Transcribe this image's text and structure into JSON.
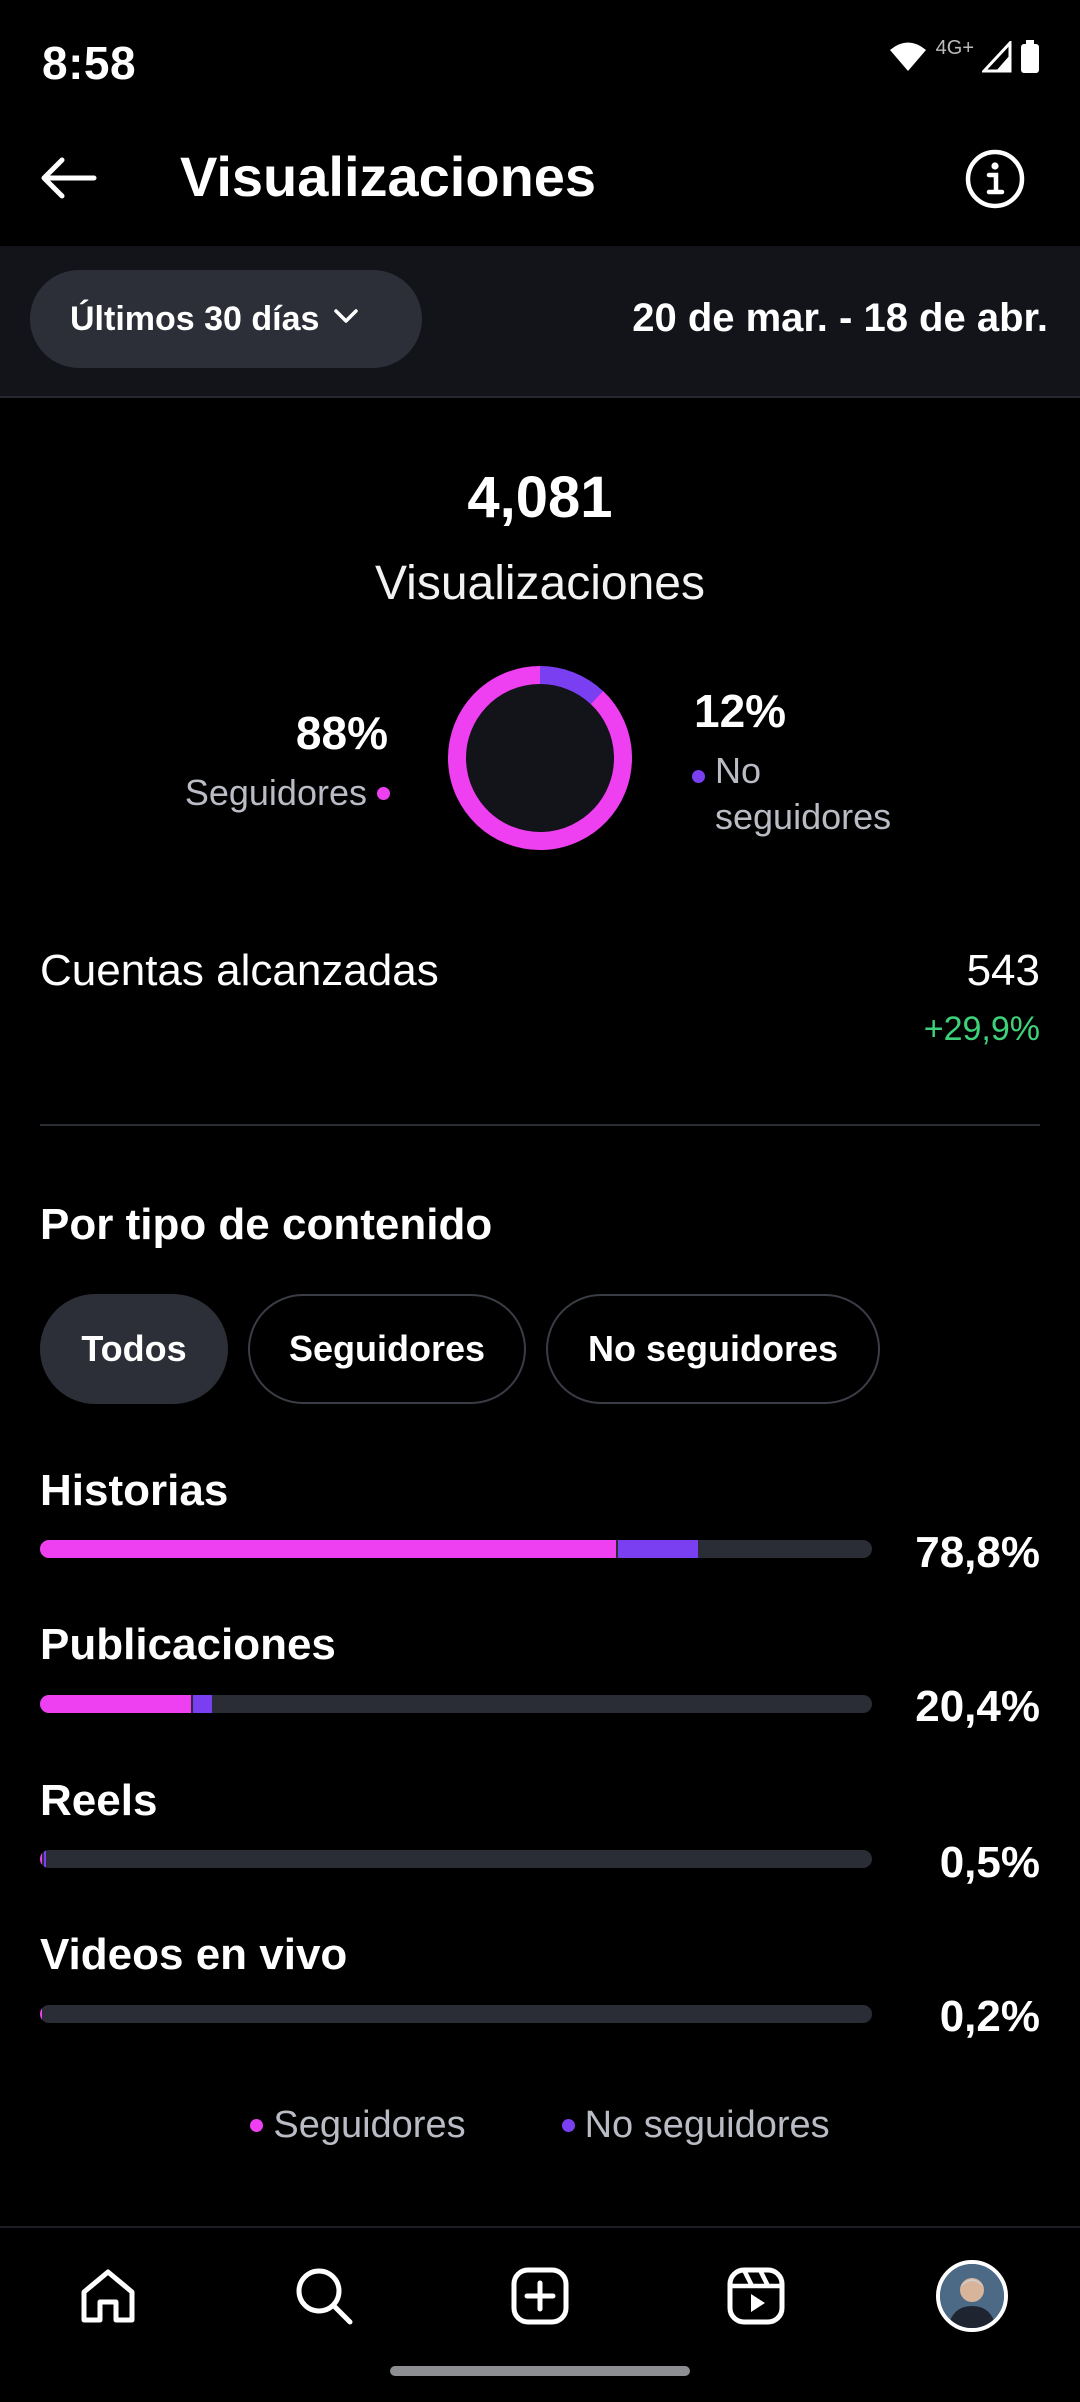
{
  "status_bar": {
    "time": "8:58",
    "network_label": "4G+",
    "icons": [
      "wifi-icon",
      "signal-icon",
      "battery-icon"
    ]
  },
  "app_bar": {
    "title": "Visualizaciones",
    "back_icon": "arrow-left-icon",
    "info_icon": "info-icon"
  },
  "filter": {
    "range_selected": "Últimos 30 días",
    "date_range": "20 de mar. - 18 de abr."
  },
  "summary": {
    "total_value": "4,081",
    "total_label": "Visualizaciones",
    "followers_pct": "88%",
    "followers_label": "Seguidores",
    "non_followers_pct": "12%",
    "non_followers_label": "No seguidores",
    "donut_share": {
      "followers": 0.88,
      "non_followers": 0.12
    }
  },
  "reach": {
    "label": "Cuentas alcanzadas",
    "value": "543",
    "change": "+29,9%"
  },
  "content_type": {
    "title": "Por tipo de contenido",
    "tabs": [
      {
        "label": "Todos",
        "active": true
      },
      {
        "label": "Seguidores",
        "active": false
      },
      {
        "label": "No seguidores",
        "active": false
      }
    ],
    "rows": [
      {
        "label": "Historias",
        "pct": "78,8%",
        "followers_share": 0.692,
        "non_followers_share": 0.096
      },
      {
        "label": "Publicaciones",
        "pct": "20,4%",
        "followers_share": 0.182,
        "non_followers_share": 0.022
      },
      {
        "label": "Reels",
        "pct": "0,5%",
        "followers_share": 0.002,
        "non_followers_share": 0.003
      },
      {
        "label": "Videos en vivo",
        "pct": "0,2%",
        "followers_share": 0.002,
        "non_followers_share": 0.0
      }
    ],
    "legend": [
      "Seguidores",
      "No seguidores"
    ]
  },
  "colors": {
    "followers": "#ee3ff0",
    "non_followers": "#7b3ff2",
    "positive": "#3ed17a",
    "track": "#2a2d35"
  },
  "nav": {
    "items": [
      "home-icon",
      "search-icon",
      "create-icon",
      "reels-icon",
      "profile-avatar"
    ]
  }
}
